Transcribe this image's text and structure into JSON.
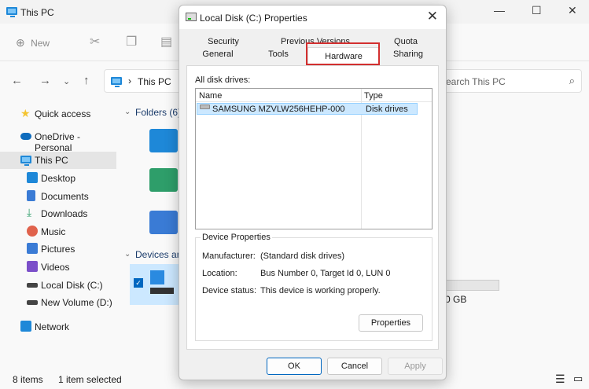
{
  "explorer": {
    "window_title": "This PC",
    "controls": {
      "minimize": "—",
      "maximize": "☐",
      "close": "✕"
    },
    "command_bar": {
      "new_label": "New"
    },
    "address": {
      "crumb": "This PC"
    },
    "search": {
      "placeholder": "earch This PC"
    },
    "sidebar": {
      "items": [
        {
          "label": "Quick access",
          "icon": "star-icon",
          "color": "#f4c430"
        },
        {
          "label": "OneDrive - Personal",
          "icon": "cloud-icon",
          "color": "#0f6cbd"
        },
        {
          "label": "This PC",
          "icon": "computer-icon",
          "color": "#1e88d8"
        },
        {
          "label": "Desktop",
          "icon": "desktop-icon",
          "color": "#1e88d8"
        },
        {
          "label": "Documents",
          "icon": "documents-icon",
          "color": "#3a7bd5"
        },
        {
          "label": "Downloads",
          "icon": "download-icon",
          "color": "#2e9e6a"
        },
        {
          "label": "Music",
          "icon": "music-icon",
          "color": "#e0624c"
        },
        {
          "label": "Pictures",
          "icon": "pictures-icon",
          "color": "#3a7bd5"
        },
        {
          "label": "Videos",
          "icon": "videos-icon",
          "color": "#7b4fc9"
        },
        {
          "label": "Local Disk (C:)",
          "icon": "drive-icon",
          "color": "#444444"
        },
        {
          "label": "New Volume (D:)",
          "icon": "drive-icon",
          "color": "#444444"
        },
        {
          "label": "Network",
          "icon": "network-icon",
          "color": "#1e88d8"
        }
      ]
    },
    "content": {
      "folders_header": "Folders (6)",
      "devices_header": "Devices and",
      "drive_free_text": "0 GB"
    },
    "status": {
      "items_count": "8 items",
      "selected": "1 item selected"
    }
  },
  "dialog": {
    "title": "Local Disk (C:) Properties",
    "close_glyph": "✕",
    "tabs_top": [
      "Security",
      "Previous Versions",
      "Quota"
    ],
    "tabs_bottom": [
      "General",
      "Tools",
      "Hardware",
      "Sharing"
    ],
    "active_tab": "Hardware",
    "all_disk_drives_label": "All disk drives:",
    "columns": [
      "Name",
      "Type"
    ],
    "drives": [
      {
        "name": "SAMSUNG MZVLW256HEHP-000",
        "type": "Disk drives"
      }
    ],
    "device_properties": {
      "title": "Device Properties",
      "rows": [
        {
          "label": "Manufacturer:",
          "value": "(Standard disk drives)"
        },
        {
          "label": "Location:",
          "value": "Bus Number 0, Target Id 0, LUN 0"
        },
        {
          "label": "Device status:",
          "value": "This device is working properly."
        }
      ],
      "properties_button": "Properties"
    },
    "buttons": {
      "ok": "OK",
      "cancel": "Cancel",
      "apply": "Apply"
    },
    "highlight_color": "#d32f2f"
  }
}
